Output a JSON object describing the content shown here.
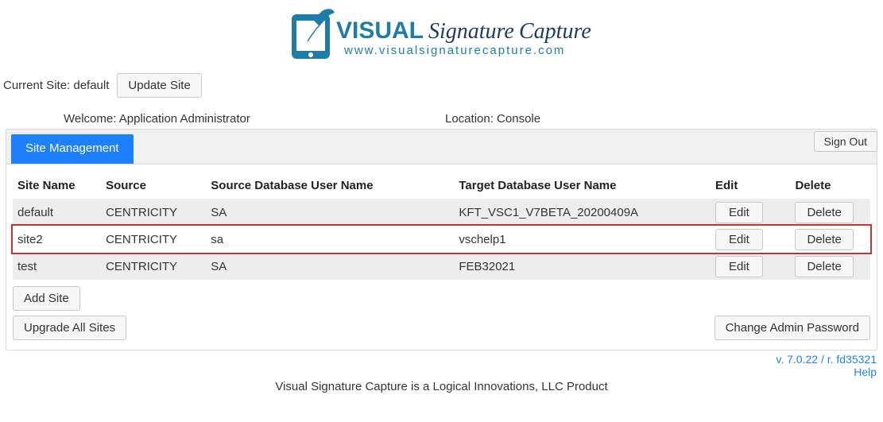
{
  "logo": {
    "brand_main": "VISUAL",
    "brand_sub1": "Signature",
    "brand_sub2": "Capture",
    "url": "www.visualsignaturecapture.com"
  },
  "site_row": {
    "label": "Current Site: default",
    "update_btn": "Update Site"
  },
  "signout_btn": "Sign Out",
  "info": {
    "welcome": "Welcome: Application Administrator",
    "location": "Location: Console"
  },
  "tab_label": "Site Management",
  "table": {
    "headers": {
      "site_name": "Site Name",
      "source": "Source",
      "source_db_user": "Source Database User Name",
      "target_db_user": "Target Database User Name",
      "edit": "Edit",
      "delete": "Delete"
    },
    "rows": [
      {
        "site_name": "default",
        "source": "CENTRICITY",
        "source_db_user": "SA",
        "target_db_user": "KFT_VSC1_V7BETA_20200409A",
        "edit": "Edit",
        "delete": "Delete",
        "highlighted": false
      },
      {
        "site_name": "site2",
        "source": "CENTRICITY",
        "source_db_user": "sa",
        "target_db_user": "vschelp1",
        "edit": "Edit",
        "delete": "Delete",
        "highlighted": true
      },
      {
        "site_name": "test",
        "source": "CENTRICITY",
        "source_db_user": "SA",
        "target_db_user": "FEB32021",
        "edit": "Edit",
        "delete": "Delete",
        "highlighted": false
      }
    ]
  },
  "add_site_btn": "Add Site",
  "upgrade_all_btn": "Upgrade All Sites",
  "change_pw_btn": "Change Admin Password",
  "footer": {
    "version": "v. 7.0.22 / r. fd35321",
    "help": "Help",
    "product": "Visual Signature Capture is a Logical Innovations, LLC Product"
  }
}
